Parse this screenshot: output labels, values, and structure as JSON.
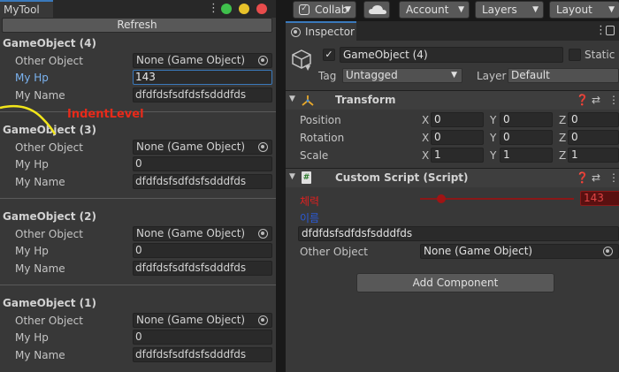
{
  "left_panel": {
    "tab_label": "MyTool",
    "refresh_label": "Refresh",
    "annotation_label": "IndentLevel",
    "window_dots": {
      "green": "#3fc04c",
      "yellow": "#e8c22a",
      "red": "#e84c4c"
    },
    "groups": [
      {
        "title": "GameObject (4)",
        "other_label": "Other Object",
        "other_value": "None (Game Object)",
        "hp_label": "My Hp",
        "hp_value": "143",
        "name_label": "My Name",
        "name_value": "dfdfdsfsdfdsfsdddfds"
      },
      {
        "title": "GameObject (3)",
        "other_label": "Other Object",
        "other_value": "None (Game Object)",
        "hp_label": "My Hp",
        "hp_value": "0",
        "name_label": "My Name",
        "name_value": "dfdfdsfsdfdsfsdddfds"
      },
      {
        "title": "GameObject (2)",
        "other_label": "Other Object",
        "other_value": "None (Game Object)",
        "hp_label": "My Hp",
        "hp_value": "0",
        "name_label": "My Name",
        "name_value": "dfdfdsfsdfdsfsdddfds"
      },
      {
        "title": "GameObject (1)",
        "other_label": "Other Object",
        "other_value": "None (Game Object)",
        "hp_label": "My Hp",
        "hp_value": "0",
        "name_label": "My Name",
        "name_value": "dfdfdsfsdfdsfsdddfds"
      }
    ]
  },
  "toolbar": {
    "collab": "Collab",
    "account": "Account",
    "layers": "Layers",
    "layout": "Layout"
  },
  "inspector": {
    "tab_label": "Inspector",
    "object_name": "GameObject (4)",
    "static_label": "Static",
    "tag_label": "Tag",
    "tag_value": "Untagged",
    "layer_label": "Layer",
    "layer_value": "Default",
    "transform": {
      "name": "Transform",
      "rows": [
        {
          "label": "Position",
          "x": "0",
          "y": "0",
          "z": "0"
        },
        {
          "label": "Rotation",
          "x": "0",
          "y": "0",
          "z": "0"
        },
        {
          "label": "Scale",
          "x": "1",
          "y": "1",
          "z": "1"
        }
      ],
      "axis_x": "X",
      "axis_y": "Y",
      "axis_z": "Z"
    },
    "custom_script": {
      "name": "Custom Script (Script)",
      "hp_label": "체력",
      "hp_value": "143",
      "hp_fraction": 0.14,
      "name_label": "이름",
      "name_value": "dfdfdsfsdfdsfsdddfds",
      "other_label": "Other Object",
      "other_value": "None (Game Object)"
    },
    "add_component_label": "Add Component"
  }
}
